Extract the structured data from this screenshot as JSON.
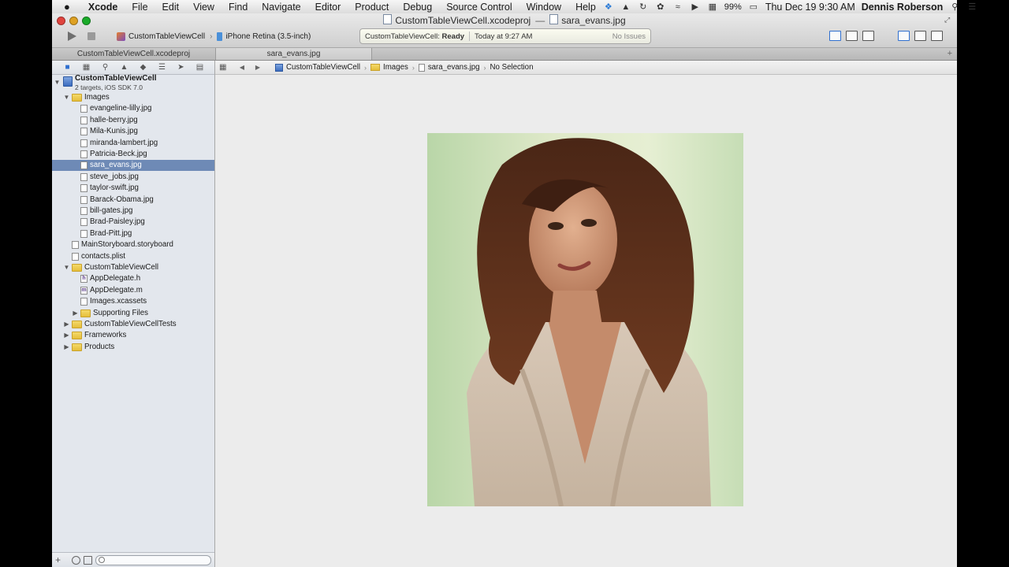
{
  "menubar": {
    "app": "Xcode",
    "items": [
      "File",
      "Edit",
      "View",
      "Find",
      "Navigate",
      "Editor",
      "Product",
      "Debug",
      "Source Control",
      "Window",
      "Help"
    ],
    "battery": "99%",
    "datetime": "Thu Dec 19  9:30 AM",
    "user": "Dennis Roberson"
  },
  "window": {
    "title_project": "CustomTableViewCell.xcodeproj",
    "title_sep": "—",
    "title_file": "sara_evans.jpg"
  },
  "toolbar": {
    "scheme": "CustomTableViewCell",
    "destination": "iPhone Retina (3.5-inch)",
    "activity": {
      "project": "CustomTableViewCell:",
      "status": "Ready",
      "time": "Today at 9:27 AM",
      "issues": "No Issues"
    }
  },
  "tabs": [
    "CustomTableViewCell.xcodeproj",
    "sara_evans.jpg"
  ],
  "navigator": {
    "project": {
      "name": "CustomTableViewCell",
      "subtitle": "2 targets, iOS SDK 7.0"
    },
    "rows": [
      {
        "label": "Images",
        "type": "folder",
        "disclosure": "open"
      },
      {
        "label": "evangeline-lilly.jpg",
        "type": "file"
      },
      {
        "label": "halle-berry.jpg",
        "type": "file"
      },
      {
        "label": "Mila-Kunis.jpg",
        "type": "file"
      },
      {
        "label": "miranda-lambert.jpg",
        "type": "file"
      },
      {
        "label": "Patricia-Beck.jpg",
        "type": "file"
      },
      {
        "label": "sara_evans.jpg",
        "type": "file",
        "selected": true
      },
      {
        "label": "steve_jobs.jpg",
        "type": "file"
      },
      {
        "label": "taylor-swift.jpg",
        "type": "file"
      },
      {
        "label": "Barack-Obama.jpg",
        "type": "file"
      },
      {
        "label": "bill-gates.jpg",
        "type": "file"
      },
      {
        "label": "Brad-Paisley.jpg",
        "type": "file"
      },
      {
        "label": "Brad-Pitt.jpg",
        "type": "file"
      },
      {
        "label": "MainStoryboard.storyboard",
        "type": "file"
      },
      {
        "label": "contacts.plist",
        "type": "file"
      },
      {
        "label": "CustomTableViewCell",
        "type": "folder",
        "disclosure": "open"
      },
      {
        "label": "AppDelegate.h",
        "type": "header"
      },
      {
        "label": "AppDelegate.m",
        "type": "impl"
      },
      {
        "label": "Images.xcassets",
        "type": "file"
      },
      {
        "label": "Supporting Files",
        "type": "folder",
        "disclosure": "closed"
      },
      {
        "label": "CustomTableViewCellTests",
        "type": "folder",
        "disclosure": "closed"
      },
      {
        "label": "Frameworks",
        "type": "folder",
        "disclosure": "closed"
      },
      {
        "label": "Products",
        "type": "folder",
        "disclosure": "closed"
      }
    ]
  },
  "jumpbar": {
    "crumbs": [
      "CustomTableViewCell",
      "Images",
      "sara_evans.jpg",
      "No Selection"
    ]
  },
  "colors": {
    "selection": "#6e8ab6",
    "navigator_bg": "#e3e7ed",
    "editor_bg": "#ececec"
  }
}
